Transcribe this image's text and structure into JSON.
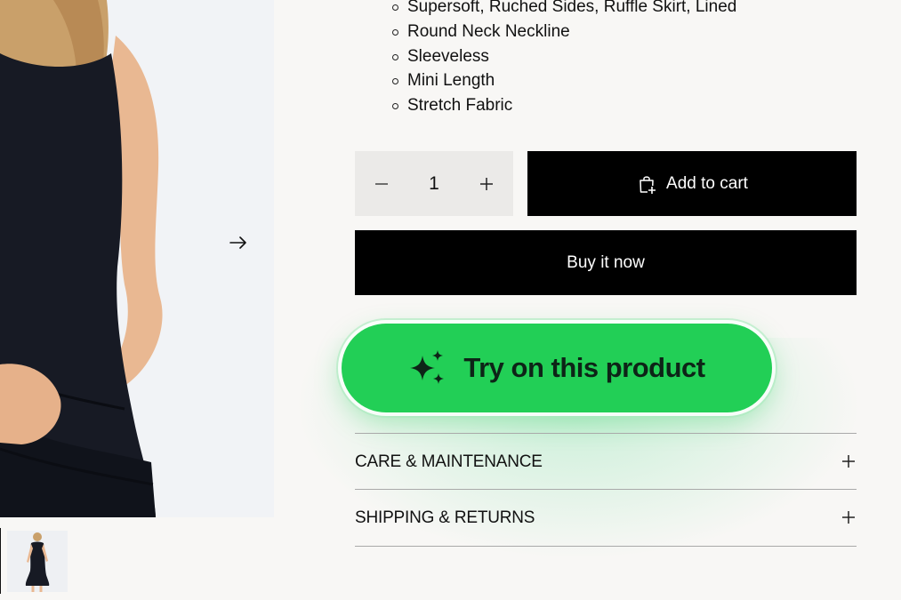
{
  "product": {
    "features": [
      "Supersoft, Ruched Sides, Ruffle Skirt, Lined",
      "Round Neck Neckline",
      "Sleeveless",
      "Mini Length",
      "Stretch Fabric"
    ]
  },
  "quantity": {
    "value": "1",
    "decrease_icon": "minus-icon",
    "increase_icon": "plus-icon"
  },
  "buttons": {
    "add_to_cart": "Add to cart",
    "add_to_cart_icon": "cart-add-icon",
    "buy_now": "Buy it now",
    "try_on": "Try on this product",
    "try_on_icon": "sparkles-icon"
  },
  "accordions": [
    {
      "title": "CARE & MAINTENANCE",
      "icon": "plus-icon"
    },
    {
      "title": "SHIPPING & RETURNS",
      "icon": "plus-icon"
    }
  ],
  "media": {
    "next_icon": "arrow-right-icon"
  },
  "colors": {
    "primary_button": "#000000",
    "try_on_green": "#22cf56",
    "qty_background": "#ebeae8"
  }
}
